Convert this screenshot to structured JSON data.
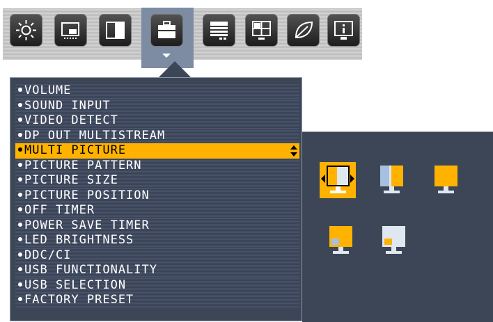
{
  "toolbar": {
    "tabs": [
      {
        "icon": "brightness-sun-icon"
      },
      {
        "icon": "picture-adjust-icon"
      },
      {
        "icon": "color-contrast-icon"
      },
      {
        "icon": "tools-toolbox-icon",
        "active": true
      },
      {
        "icon": "menu-tools-icon"
      },
      {
        "icon": "multi-screen-icon"
      },
      {
        "icon": "eco-leaf-icon"
      },
      {
        "icon": "information-icon"
      }
    ]
  },
  "menu": {
    "items": [
      "VOLUME",
      "SOUND INPUT",
      "VIDEO DETECT",
      "DP OUT MULTISTREAM",
      "MULTI PICTURE",
      "PICTURE PATTERN",
      "PICTURE SIZE",
      "PICTURE POSITION",
      "OFF TIMER",
      "POWER SAVE TIMER",
      "LED BRIGHTNESS",
      "DDC/CI",
      "USB FUNCTIONALITY",
      "USB SELECTION",
      "FACTORY PRESET"
    ],
    "selected_index": 4
  },
  "submenu": {
    "options": [
      {
        "name": "multi-picture-off-option",
        "selected": true
      },
      {
        "name": "picture-by-picture-aspect-option",
        "selected": false
      },
      {
        "name": "picture-by-picture-full-option",
        "selected": false
      },
      {
        "name": "picture-in-picture-bottom-left-option",
        "selected": false
      },
      {
        "name": "picture-in-picture-small-option",
        "selected": false
      }
    ]
  },
  "colors": {
    "panel": "#3d4656",
    "highlight": "#ffb300",
    "active_tab": "#7d8ca3",
    "screen_light": "#dfe7f0"
  }
}
